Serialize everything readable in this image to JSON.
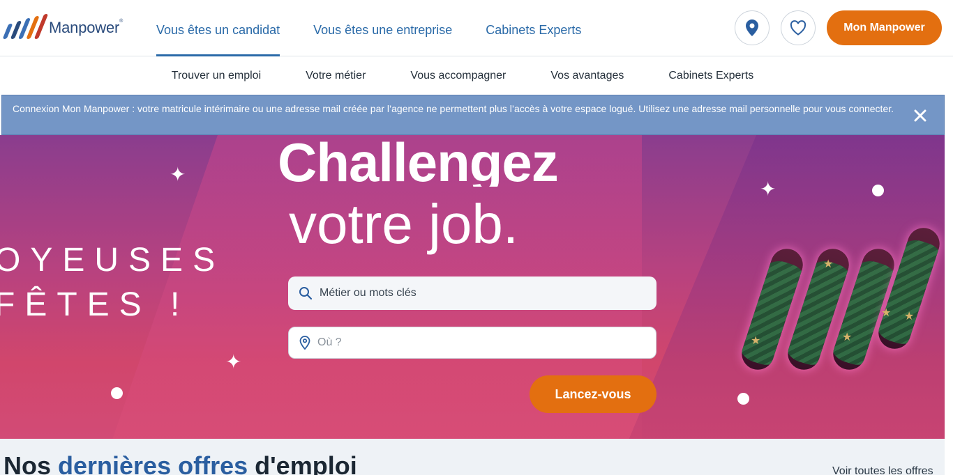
{
  "brand": {
    "name": "Manpower",
    "colors": {
      "primary_blue": "#2a6aa8",
      "orange": "#e36f10",
      "logo_marks": [
        "#3b6fb5",
        "#2a4b7c",
        "#e36f10",
        "#c0392b"
      ]
    }
  },
  "header": {
    "nav": [
      {
        "label": "Vous êtes un candidat",
        "active": true
      },
      {
        "label": "Vous êtes une entreprise",
        "active": false
      },
      {
        "label": "Cabinets Experts",
        "active": false
      }
    ],
    "location_button_icon": "map-pin-icon",
    "favorites_button_icon": "heart-icon",
    "account_button": "Mon Manpower"
  },
  "subnav": {
    "items": [
      "Trouver un emploi",
      "Votre métier",
      "Vous accompagner",
      "Vos avantages",
      "Cabinets Experts"
    ]
  },
  "notice": {
    "text": "Connexion Mon Manpower : votre matricule intérimaire ou une adresse mail créée par l’agence ne permettent plus l’accès à votre espace logué. Utilisez une adresse mail personnelle pour vous connecter.",
    "close_icon": "close-icon"
  },
  "hero": {
    "headline_bold": "Challengez",
    "headline_light": "votre job.",
    "side_text_line1": "OYEUSES",
    "side_text_line2": "FÊTES !",
    "search_what_placeholder": "Métier ou mots clés",
    "search_where_placeholder": "Où ?",
    "cta": "Lancez-vous"
  },
  "jobs_section": {
    "title_part1": "Nos ",
    "title_accent": "dernières offres",
    "title_part2": " d'emploi",
    "see_all": "Voir toutes les offres"
  }
}
